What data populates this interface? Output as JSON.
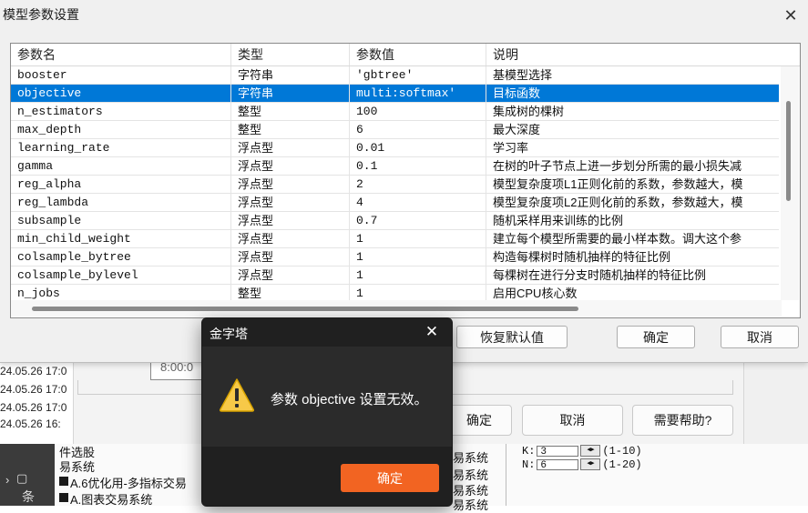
{
  "dialog": {
    "title": "模型参数设置",
    "close_glyph": "✕",
    "columns": [
      "参数名",
      "类型",
      "参数值",
      "说明"
    ],
    "rows": [
      {
        "name": "booster",
        "type": "字符串",
        "value": "'gbtree'",
        "desc": "基模型选择"
      },
      {
        "name": "objective",
        "type": "字符串",
        "value": "multi:softmax'",
        "desc": "目标函数",
        "selected": true
      },
      {
        "name": "n_estimators",
        "type": "整型",
        "value": "100",
        "desc": "集成树的棵树"
      },
      {
        "name": "max_depth",
        "type": "整型",
        "value": "6",
        "desc": "最大深度"
      },
      {
        "name": "learning_rate",
        "type": "浮点型",
        "value": "0.01",
        "desc": "学习率"
      },
      {
        "name": "gamma",
        "type": "浮点型",
        "value": "0.1",
        "desc": "在树的叶子节点上进一步划分所需的最小损失减"
      },
      {
        "name": "reg_alpha",
        "type": "浮点型",
        "value": "2",
        "desc": "模型复杂度项L1正则化前的系数，参数越大，模"
      },
      {
        "name": "reg_lambda",
        "type": "浮点型",
        "value": "4",
        "desc": "模型复杂度项L2正则化前的系数，参数越大，模"
      },
      {
        "name": "subsample",
        "type": "浮点型",
        "value": "0.7",
        "desc": "随机采样用来训练的比例"
      },
      {
        "name": "min_child_weight",
        "type": "浮点型",
        "value": "1",
        "desc": "建立每个模型所需要的最小样本数。调大这个参"
      },
      {
        "name": "colsample_bytree",
        "type": "浮点型",
        "value": "1",
        "desc": "构造每棵树时随机抽样的特征比例"
      },
      {
        "name": "colsample_bylevel",
        "type": "浮点型",
        "value": "1",
        "desc": "每棵树在进行分支时随机抽样的特征比例"
      },
      {
        "name": "n_jobs",
        "type": "整型",
        "value": "1",
        "desc": "启用CPU核心数"
      }
    ],
    "buttons": {
      "restore": "恢复默认值",
      "ok": "确定",
      "cancel": "取消"
    }
  },
  "alert": {
    "title": "金字塔",
    "close_glyph": "✕",
    "message": "参数 objective 设置无效。",
    "ok": "确定",
    "icon": "warning-icon",
    "accent": "#f26422"
  },
  "background": {
    "timestamps": [
      "24.05.26 17:0",
      "24.05.26 17:0",
      "24.05.26 17:0",
      "24.05.26 16:"
    ],
    "time_value": "8:00:0",
    "buttons": {
      "ok": "确定",
      "cancel": "取消",
      "help": "需要帮助?"
    },
    "lines": [
      "件选股",
      "易系统",
      "A.6优化用-多指标交易",
      "A.图表交易系统"
    ],
    "right_lines": [
      "易系统",
      "易系统",
      "易系统",
      "易系统"
    ],
    "folder_label": "条",
    "k_label": "K:",
    "k_value": "3",
    "k_range": "(1-10)",
    "n_label": "N:",
    "n_value": "6",
    "n_range": "(1-20)"
  }
}
